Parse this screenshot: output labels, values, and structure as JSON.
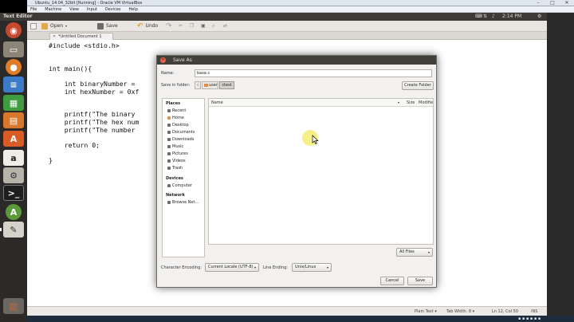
{
  "vbox": {
    "title": "Ubuntu_14.04_32bit [Running] - Oracle VM VirtualBox",
    "menu": [
      "File",
      "Machine",
      "View",
      "Input",
      "Devices",
      "Help"
    ],
    "controls": [
      "–",
      "□",
      "✕"
    ]
  },
  "panel": {
    "app_name": "Text Editor",
    "time": "2:14 PM"
  },
  "editor": {
    "toolbar": {
      "open_label": "Open",
      "save_label": "Save",
      "undo_label": "Undo"
    },
    "tab_label": "*Untitled Document 1",
    "code": "#include <stdio.h>\n\n\nint main(){\n\n    int binaryNumber =\n    int hexNumber = 0xf\n\n\n    printf(\"The binary\n    printf(\"The hex num\n    printf(\"The number\n\n    return 0;\n\n}",
    "status": {
      "language": "Plain Text ▾",
      "tab_width": "Tab Width: 8 ▾",
      "position": "Ln 12, Col 50",
      "mode": "INS"
    }
  },
  "dialog": {
    "title": "Save As",
    "name_label": "Name:",
    "name_value": "base.c",
    "save_in_label": "Save in folder:",
    "path": [
      "user",
      "ctest"
    ],
    "create_folder_label": "Create Folder",
    "places_header": "Places",
    "places": [
      {
        "label": "Recent",
        "icon": "clock-icon"
      },
      {
        "label": "Home",
        "icon": "home-icon"
      },
      {
        "label": "Desktop",
        "icon": "desktop-icon"
      },
      {
        "label": "Documents",
        "icon": "folder-icon"
      },
      {
        "label": "Downloads",
        "icon": "download-icon"
      },
      {
        "label": "Music",
        "icon": "music-icon"
      },
      {
        "label": "Pictures",
        "icon": "image-icon"
      },
      {
        "label": "Videos",
        "icon": "video-icon"
      },
      {
        "label": "Trash",
        "icon": "trash-icon"
      }
    ],
    "devices_header": "Devices",
    "devices": [
      {
        "label": "Computer",
        "icon": "computer-icon"
      }
    ],
    "network_header": "Network",
    "network": [
      {
        "label": "Browse Net...",
        "icon": "network-icon"
      }
    ],
    "columns": {
      "name": "Name",
      "size": "Size",
      "modified": "Modifie"
    },
    "filter_value": "All Files",
    "encoding_label": "Character Encoding:",
    "encoding_value": "Current Locale (UTF-8)",
    "line_ending_label": "Line Ending:",
    "line_ending_value": "Unix/Linux",
    "cancel_label": "Cancel",
    "save_label": "Save"
  },
  "colors": {
    "ubuntu_panel": "#3c3b37",
    "launcher": "#2c2a28",
    "close_button": "#e8674a"
  }
}
